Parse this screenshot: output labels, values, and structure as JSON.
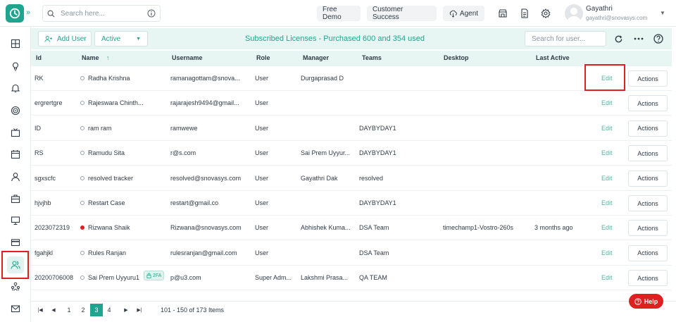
{
  "topbar": {
    "search_placeholder": "Search here...",
    "free_demo": "Free Demo",
    "customer_success": "Customer Success",
    "agent": "Agent",
    "user_name": "Gayathri",
    "user_email": "gayathri@snovasys.com"
  },
  "toolbar": {
    "add_user": "Add User",
    "status": "Active",
    "license_text": "Subscribed Licenses - Purchased 600 and 354 used",
    "user_search_placeholder": "Search for user..."
  },
  "table": {
    "headers": [
      "Id",
      "Name",
      "Username",
      "Role",
      "Manager",
      "Teams",
      "Desktop",
      "Last Active"
    ],
    "edit_label": "Edit",
    "actions_label": "Actions",
    "rows": [
      {
        "id": "RK",
        "name": "Radha Krishna",
        "username": "ramanagottam@snova...",
        "role": "User",
        "manager": "Durgaprasad D",
        "teams": "",
        "desktop": "",
        "last_active": ""
      },
      {
        "id": "ergrertgre",
        "name": "Rajeswara Chinth...",
        "username": "rajarajesh9494@gmail...",
        "role": "User",
        "manager": "",
        "teams": "",
        "desktop": "",
        "last_active": ""
      },
      {
        "id": "ID",
        "name": "ram ram",
        "username": "ramwewe",
        "role": "User",
        "manager": "",
        "teams": "DAYBYDAY1",
        "desktop": "",
        "last_active": ""
      },
      {
        "id": "RS",
        "name": "Ramudu Sita",
        "username": "r@s.com",
        "role": "User",
        "manager": "Sai Prem Uyyur...",
        "teams": "DAYBYDAY1",
        "desktop": "",
        "last_active": ""
      },
      {
        "id": "sgxscfc",
        "name": "resolved tracker",
        "username": "resolved@snovasys.com",
        "role": "User",
        "manager": "Gayathri Dak",
        "teams": "resolved",
        "desktop": "",
        "last_active": ""
      },
      {
        "id": "hjvjhb",
        "name": "Restart Case",
        "username": "restart@gmail.co",
        "role": "User",
        "manager": "",
        "teams": "DAYBYDAY1",
        "desktop": "",
        "last_active": ""
      },
      {
        "id": "2023072319",
        "name": "Rizwana Shaik",
        "username": "Rizwana@snovasys.com",
        "role": "User",
        "manager": "Abhishek Kuma...",
        "teams": "DSA Team",
        "desktop": "timechamp1-Vostro-260s",
        "last_active": "3 months ago"
      },
      {
        "id": "fgahjkl",
        "name": "Rules Ranjan",
        "username": "rulesranjan@gmail.com",
        "role": "User",
        "manager": "",
        "teams": "DSA Team",
        "desktop": "",
        "last_active": ""
      },
      {
        "id": "20200706008",
        "name": "Sai Prem Uyyuru1",
        "username": "p@u3.com",
        "role": "Super Adm...",
        "manager": "Lakshmi Prasa...",
        "teams": "QA TEAM",
        "desktop": "",
        "last_active": "",
        "badge": "2FA"
      }
    ]
  },
  "pager": {
    "pages": [
      "1",
      "2",
      "3",
      "4"
    ],
    "active_page": "3",
    "info": "101 - 150 of 173 Items"
  },
  "help_label": "Help",
  "colors": {
    "accent": "#1fa58f",
    "highlight": "#e02020",
    "toolbar_bg": "#e7f6f3"
  }
}
